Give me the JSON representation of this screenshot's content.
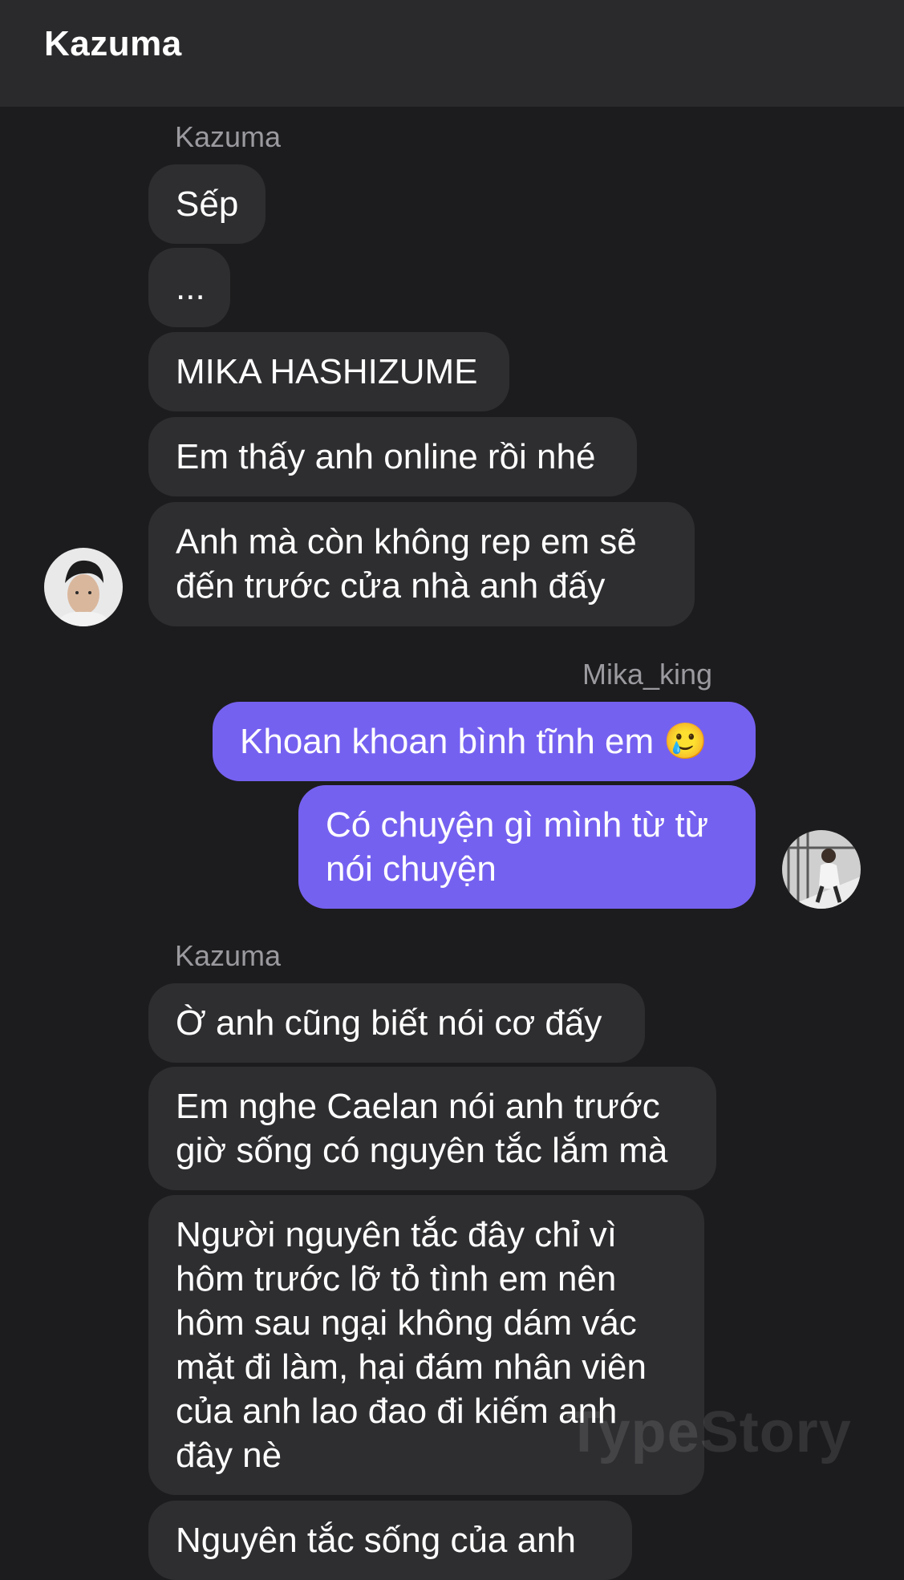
{
  "header": {
    "title": "Kazuma"
  },
  "groups": [
    {
      "sender": "Kazuma"
    },
    {
      "sender": "Mika_king"
    },
    {
      "sender": "Kazuma"
    }
  ],
  "messages": [
    "Sếp",
    "...",
    "MIKA HASHIZUME",
    "Em thấy anh online rồi nhé",
    "Anh mà còn không rep em sẽ\nđến trước cửa nhà anh đấy",
    "Khoan khoan bình tĩnh em 🥲",
    "Có chuyện gì mình từ từ\nnói chuyện",
    "Ờ anh cũng biết nói cơ đấy",
    "Em nghe Caelan nói anh trước\ngiờ sống có nguyên tắc lắm mà",
    "Người nguyên tắc đây chỉ vì\nhôm trước lỡ tỏ tình em nên\nhôm sau ngại không dám vác\nmặt đi làm, hại đám nhân viên\ncủa anh lao đao đi kiếm anh\nđây nè",
    "Nguyên tắc sống của anh"
  ],
  "watermark": "TypeStory",
  "colors": {
    "background": "#1c1c1e",
    "header": "#2a2a2c",
    "incoming_bubble": "#2e2e31",
    "outgoing_bubble": "#7561f0"
  }
}
